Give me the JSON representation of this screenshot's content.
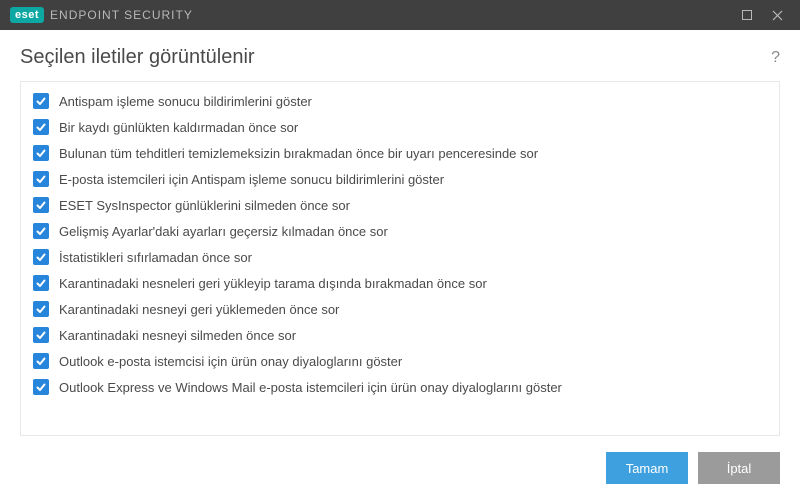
{
  "titlebar": {
    "brand_badge": "eset",
    "brand_product": "ENDPOINT SECURITY"
  },
  "header": {
    "title": "Seçilen iletiler görüntülenir",
    "help_symbol": "?"
  },
  "messages": [
    {
      "checked": true,
      "label": "Antispam işleme sonucu bildirimlerini göster"
    },
    {
      "checked": true,
      "label": "Bir kaydı günlükten kaldırmadan önce sor"
    },
    {
      "checked": true,
      "label": "Bulunan tüm tehditleri temizlemeksizin bırakmadan önce bir uyarı penceresinde sor"
    },
    {
      "checked": true,
      "label": "E-posta istemcileri için Antispam işleme sonucu bildirimlerini göster"
    },
    {
      "checked": true,
      "label": "ESET SysInspector günlüklerini silmeden önce sor"
    },
    {
      "checked": true,
      "label": "Gelişmiş Ayarlar'daki ayarları geçersiz kılmadan önce sor"
    },
    {
      "checked": true,
      "label": "İstatistikleri sıfırlamadan önce sor"
    },
    {
      "checked": true,
      "label": "Karantinadaki nesneleri geri yükleyip tarama dışında bırakmadan önce sor"
    },
    {
      "checked": true,
      "label": "Karantinadaki nesneyi geri yüklemeden önce sor"
    },
    {
      "checked": true,
      "label": "Karantinadaki nesneyi silmeden önce sor"
    },
    {
      "checked": true,
      "label": "Outlook e-posta istemcisi için ürün onay diyaloglarını göster"
    },
    {
      "checked": true,
      "label": "Outlook Express ve Windows Mail e-posta istemcileri için ürün onay diyaloglarını göster"
    }
  ],
  "footer": {
    "ok_label": "Tamam",
    "cancel_label": "İptal"
  }
}
